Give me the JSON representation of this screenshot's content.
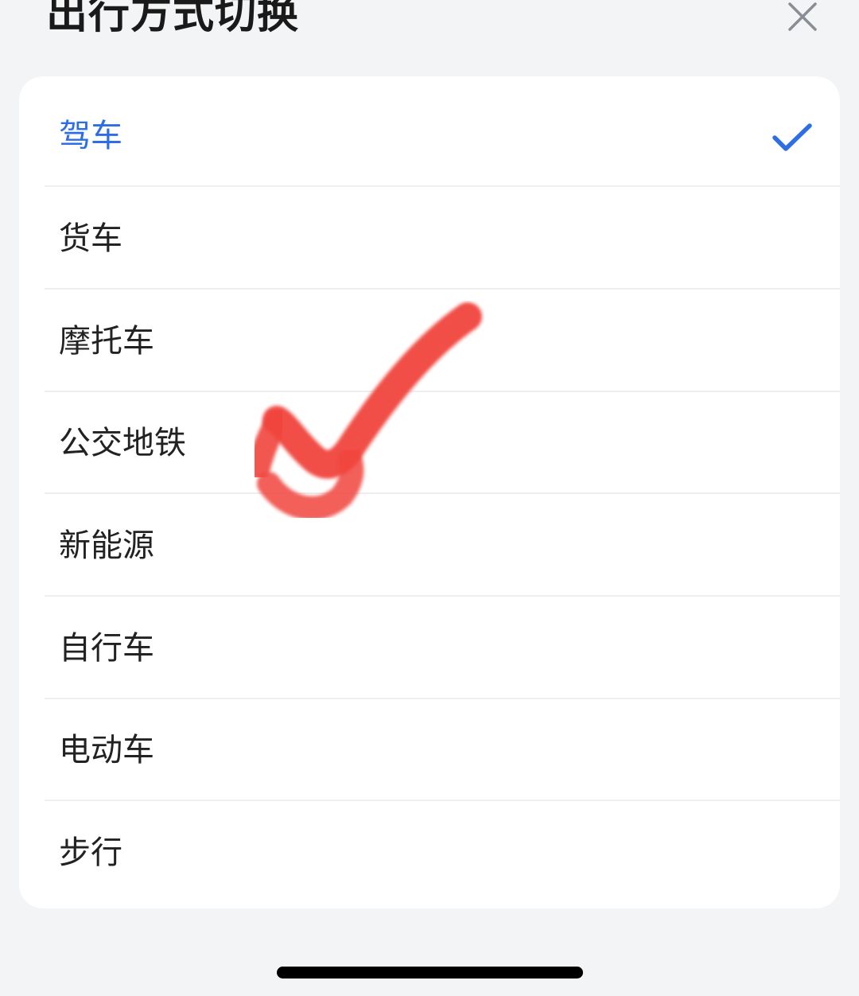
{
  "header": {
    "title": "出行方式切换",
    "close_icon": "close-icon"
  },
  "modes": {
    "selected_index": 0,
    "accent_color": "#2d6ee6",
    "items": [
      {
        "label": "驾车",
        "selected": true
      },
      {
        "label": "货车",
        "selected": false
      },
      {
        "label": "摩托车",
        "selected": false
      },
      {
        "label": "公交地铁",
        "selected": false
      },
      {
        "label": "新能源",
        "selected": false
      },
      {
        "label": "自行车",
        "selected": false
      },
      {
        "label": "电动车",
        "selected": false
      },
      {
        "label": "步行",
        "selected": false
      }
    ]
  },
  "overlay": {
    "annotation": "red-checkmark-mark",
    "annotation_color": "#f0443e"
  },
  "system": {
    "home_indicator": "home-indicator-bar"
  }
}
